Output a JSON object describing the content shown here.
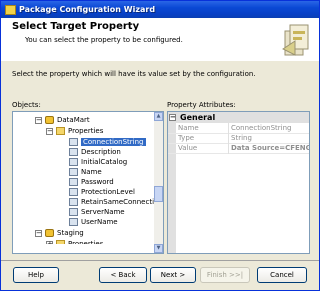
{
  "window": {
    "title": "Package Configuration Wizard"
  },
  "banner": {
    "heading": "Select Target Property",
    "subtitle": "You can select the property to be configured."
  },
  "instruction": "Select the property which will have its value set by the configuration.",
  "objects_label": "Objects:",
  "attributes_label": "Property Attributes:",
  "tree": {
    "database": "DataMart",
    "properties_folder": "Properties",
    "properties": [
      "ConnectionString",
      "Description",
      "InitialCatalog",
      "Name",
      "Password",
      "ProtectionLevel",
      "RetainSameConnection",
      "ServerName",
      "UserName"
    ],
    "selected": "ConnectionString",
    "next_node": "Staging",
    "cut_node": "Properties"
  },
  "attributes": {
    "section": "General",
    "rows": [
      {
        "name": "Name",
        "value": "ConnectionString"
      },
      {
        "name": "Type",
        "value": "String"
      },
      {
        "name": "Value",
        "value": "Data Source=CFENG"
      }
    ]
  },
  "buttons": {
    "help": "Help",
    "back": "< Back",
    "next": "Next >",
    "finish": "Finish >>|",
    "cancel": "Cancel"
  },
  "colors": {
    "title_bar": "#0a48d4",
    "selection": "#316ac5",
    "dialog_bg": "#ece9d8"
  },
  "icons": [
    "folder-icon",
    "database-icon",
    "property-icon",
    "wizard-art-icon"
  ]
}
